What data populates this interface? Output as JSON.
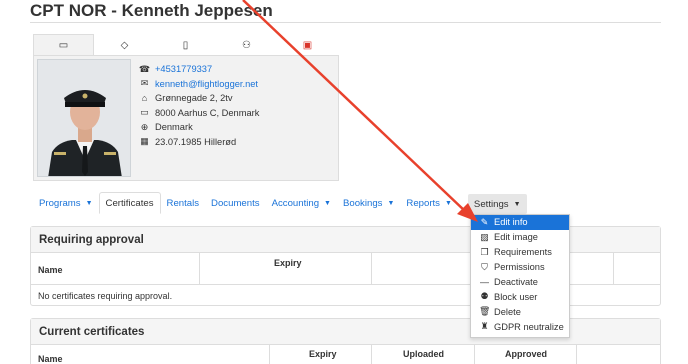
{
  "page": {
    "title": "CPT NOR - Kenneth Jeppesen"
  },
  "profile_tabs": [
    {
      "icon": "id-card-icon",
      "glyph": "▭"
    },
    {
      "icon": "tag-icon",
      "glyph": "◇"
    },
    {
      "icon": "clipboard-icon",
      "glyph": "▯"
    },
    {
      "icon": "people-icon",
      "glyph": "⚇"
    },
    {
      "icon": "id-card-red-icon",
      "glyph": "▣"
    }
  ],
  "profile": {
    "phone": "+4531779337",
    "email": "kenneth@flightlogger.net",
    "street": "Grønnegade 2, 2tv",
    "city": "8000 Aarhus C, Denmark",
    "country": "Denmark",
    "birth": "23.07.1985 Hillerød"
  },
  "main_tabs": {
    "programs": "Programs",
    "certificates": "Certificates",
    "rentals": "Rentals",
    "documents": "Documents",
    "accounting": "Accounting",
    "bookings": "Bookings",
    "reports": "Reports",
    "settings": "Settings"
  },
  "requiring_approval": {
    "title": "Requiring approval",
    "col_name": "Name",
    "col_expiry": "Expiry",
    "empty": "No certificates requiring approval."
  },
  "current_certificates": {
    "title": "Current certificates",
    "col_name": "Name",
    "col_expiry": "Expiry",
    "col_uploaded": "Uploaded",
    "col_approved": "Approved"
  },
  "settings_menu": [
    {
      "label": "Edit info",
      "icon": "pencil-icon",
      "glyph": "✎"
    },
    {
      "label": "Edit image",
      "icon": "image-icon",
      "glyph": "▨"
    },
    {
      "label": "Requirements",
      "icon": "copy-icon",
      "glyph": "❐"
    },
    {
      "label": "Permissions",
      "icon": "shield-icon",
      "glyph": "⛉"
    },
    {
      "label": "Deactivate",
      "icon": "minus-icon",
      "glyph": "—"
    },
    {
      "label": "Block user",
      "icon": "user-lock-icon",
      "glyph": "⚉"
    },
    {
      "label": "Delete",
      "icon": "trash-icon",
      "glyph": "🗑"
    },
    {
      "label": "GDPR neutralize",
      "icon": "user-secret-icon",
      "glyph": "♜"
    }
  ],
  "colors": {
    "link": "#1a73d8",
    "highlight": "#1a73d8",
    "arrow": "#e8412c",
    "red_icon": "#d9342b"
  }
}
